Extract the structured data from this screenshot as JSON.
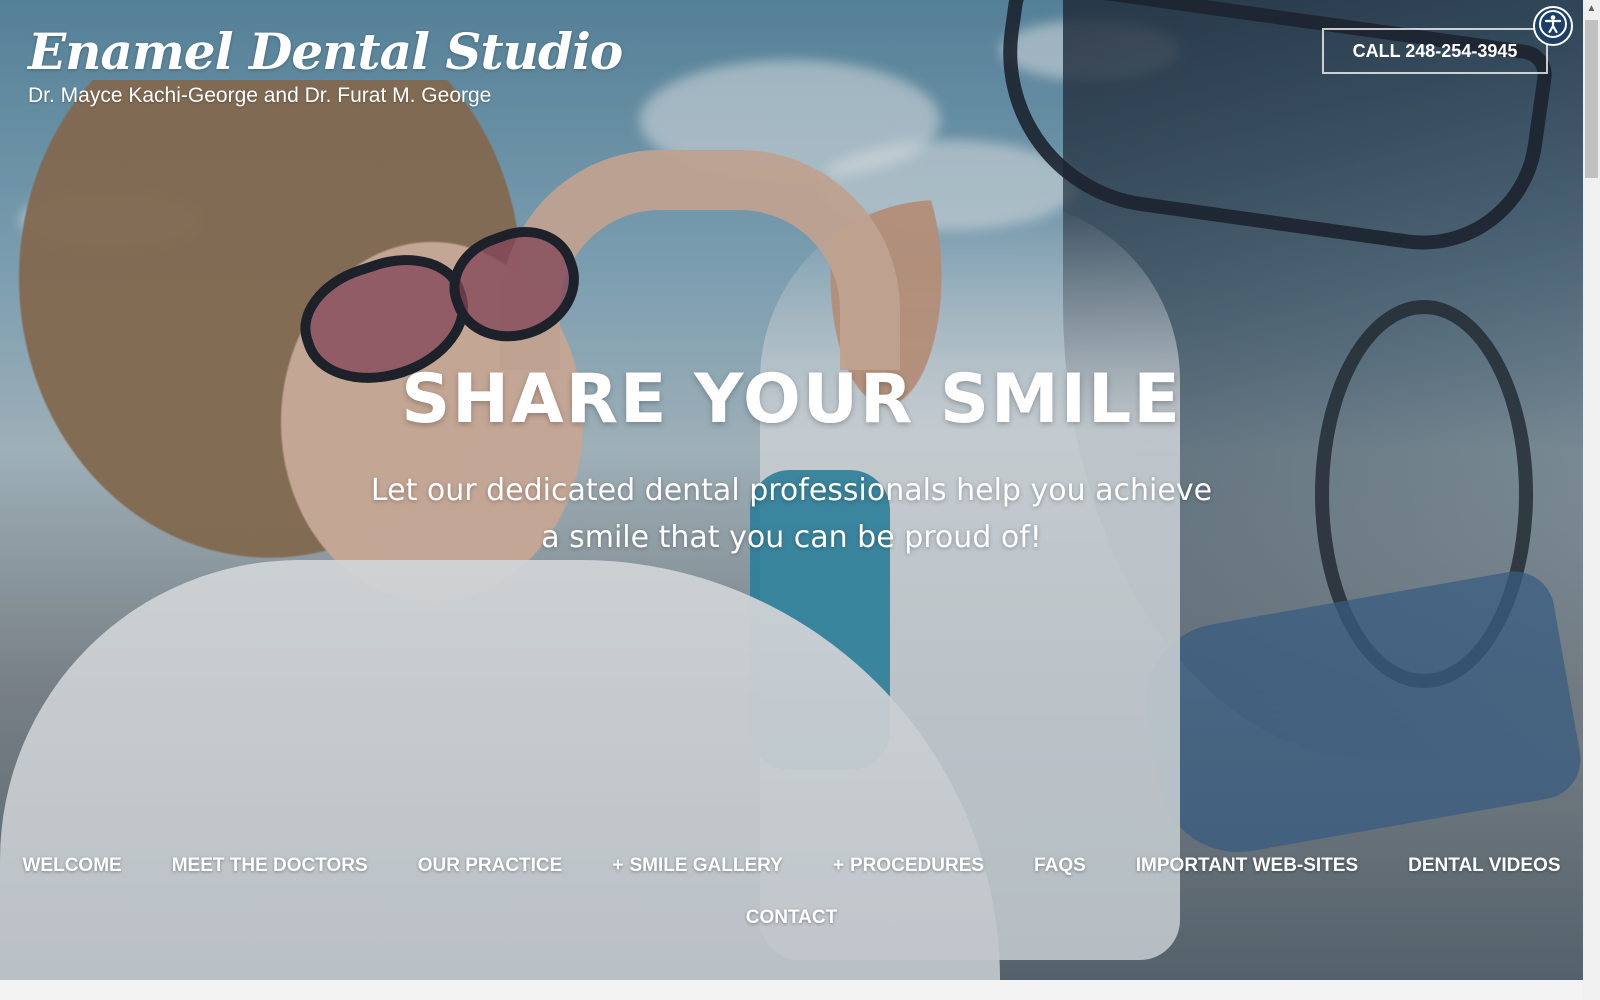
{
  "header": {
    "brand_title": "Enamel Dental Studio",
    "brand_subtitle": "Dr. Mayce Kachi-George and Dr. Furat M. George",
    "call_label": "CALL 248-254-3945",
    "accessibility_icon": "accessibility-icon"
  },
  "hero": {
    "title": "SHARE YOUR SMILE",
    "description": "Let our dedicated dental professionals help you achieve a smile that you can be proud of!"
  },
  "nav": {
    "items": [
      {
        "label": "WELCOME",
        "has_submenu": false
      },
      {
        "label": "MEET THE DOCTORS",
        "has_submenu": false
      },
      {
        "label": "OUR PRACTICE",
        "has_submenu": false
      },
      {
        "label": "SMILE GALLERY",
        "has_submenu": true
      },
      {
        "label": "PROCEDURES",
        "has_submenu": true
      },
      {
        "label": "FAQS",
        "has_submenu": false
      },
      {
        "label": "IMPORTANT WEB-SITES",
        "has_submenu": false
      },
      {
        "label": "DENTAL VIDEOS",
        "has_submenu": false
      },
      {
        "label": "CONTACT",
        "has_submenu": false
      }
    ],
    "submenu_marker": "+"
  },
  "colors": {
    "accessibility_bg": "#1b3f66",
    "text": "#ffffff"
  }
}
